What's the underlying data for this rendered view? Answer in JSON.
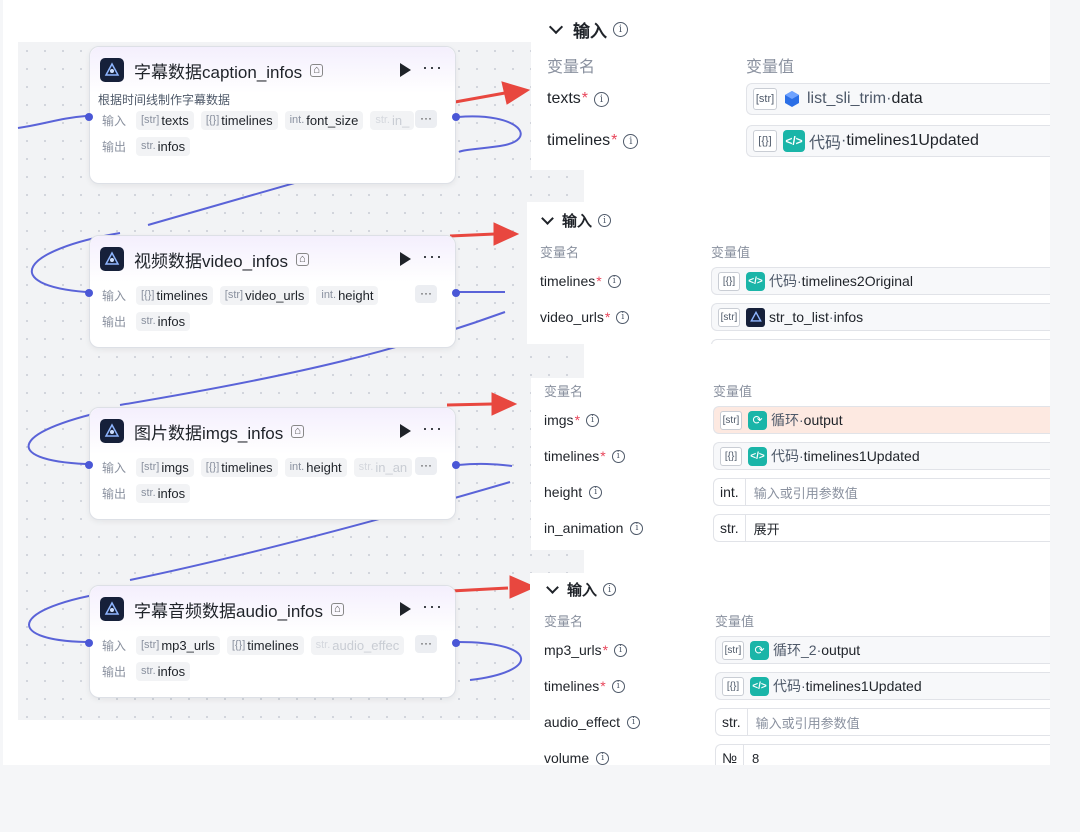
{
  "nodes": [
    {
      "title": "字幕数据caption_infos",
      "description": "根据时间线制作字幕数据",
      "input_label": "输入",
      "output_label": "输出",
      "inputs": [
        {
          "type": "[str]",
          "name": "texts"
        },
        {
          "type": "[{}]",
          "name": "timelines"
        },
        {
          "type": "int.",
          "name": "font_size"
        },
        {
          "type": "str.",
          "name": "in_"
        }
      ],
      "outputs": [
        {
          "type": "str.",
          "name": "infos"
        }
      ]
    },
    {
      "title": "视频数据video_infos",
      "description": "",
      "input_label": "输入",
      "output_label": "输出",
      "inputs": [
        {
          "type": "[{}]",
          "name": "timelines"
        },
        {
          "type": "[str]",
          "name": "video_urls"
        },
        {
          "type": "int.",
          "name": "height"
        }
      ],
      "outputs": [
        {
          "type": "str.",
          "name": "infos"
        }
      ]
    },
    {
      "title": "图片数据imgs_infos",
      "description": "",
      "input_label": "输入",
      "output_label": "输出",
      "inputs": [
        {
          "type": "[str]",
          "name": "imgs"
        },
        {
          "type": "[{}]",
          "name": "timelines"
        },
        {
          "type": "int.",
          "name": "height"
        },
        {
          "type": "str.",
          "name": "in_an"
        }
      ],
      "outputs": [
        {
          "type": "str.",
          "name": "infos"
        }
      ]
    },
    {
      "title": "字幕音频数据audio_infos",
      "description": "",
      "input_label": "输入",
      "output_label": "输出",
      "inputs": [
        {
          "type": "[str]",
          "name": "mp3_urls"
        },
        {
          "type": "[{}]",
          "name": "timelines"
        },
        {
          "type": "str.",
          "name": "audio_effec"
        }
      ],
      "outputs": [
        {
          "type": "str.",
          "name": "infos"
        }
      ]
    }
  ],
  "panels": [
    {
      "section": "输入",
      "col_name": "变量名",
      "col_value": "变量值",
      "rows": [
        {
          "name": "texts",
          "required": "*",
          "type": "[str]",
          "source": "list_sli_trim",
          "sep": " · ",
          "field": "data",
          "icon": "cube-icon"
        },
        {
          "name": "timelines",
          "required": "*",
          "type": "[{}]",
          "source": "代码",
          "sep": " · ",
          "field": "timelines1Updated",
          "icon": "code-icon"
        }
      ]
    },
    {
      "section": "输入",
      "col_name": "变量名",
      "col_value": "变量值",
      "rows": [
        {
          "name": "timelines",
          "required": "*",
          "type": "[{}]",
          "source": "代码",
          "sep": " · ",
          "field": "timelines2Original",
          "icon": "code-icon"
        },
        {
          "name": "video_urls",
          "required": "*",
          "type": "[str]",
          "source": "str_to_list",
          "sep": " · ",
          "field": "infos",
          "icon": "plugin-icon"
        }
      ]
    },
    {
      "section": "",
      "col_name": "变量名",
      "col_value": "变量值",
      "rows": [
        {
          "name": "imgs",
          "required": "*",
          "type": "[str]",
          "source": "循环",
          "sep": " · ",
          "field": "output",
          "icon": "loop-icon"
        },
        {
          "name": "timelines",
          "required": "*",
          "type": "[{}]",
          "source": "代码",
          "sep": " · ",
          "field": "timelines1Updated",
          "icon": "code-icon"
        },
        {
          "name": "height",
          "required": "",
          "type": "int.",
          "placeholder": "输入或引用参数值"
        },
        {
          "name": "in_animation",
          "required": "",
          "type": "str.",
          "value": "展开"
        }
      ]
    },
    {
      "section": "输入",
      "col_name": "变量名",
      "col_value": "变量值",
      "rows": [
        {
          "name": "mp3_urls",
          "required": "*",
          "type": "[str]",
          "source": "循环_2",
          "sep": " · ",
          "field": "output",
          "icon": "loop-icon"
        },
        {
          "name": "timelines",
          "required": "*",
          "type": "[{}]",
          "source": "代码",
          "sep": " · ",
          "field": "timelines1Updated",
          "icon": "code-icon"
        },
        {
          "name": "audio_effect",
          "required": "",
          "type": "str.",
          "placeholder": "输入或引用参数值"
        },
        {
          "name": "volume",
          "required": "",
          "type": "№",
          "value": "8"
        }
      ]
    }
  ],
  "colors": {
    "accent": "#4a57d6",
    "arrow": "#e8473f",
    "code_icon": "#1ab5a8",
    "required": "#e8455a"
  }
}
